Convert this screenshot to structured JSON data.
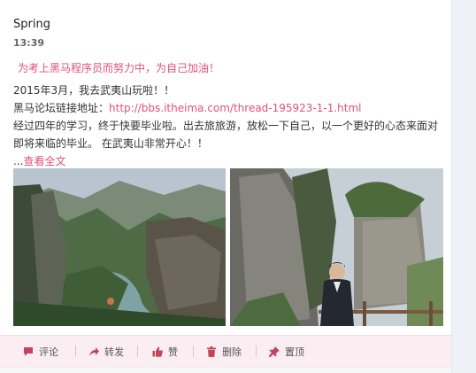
{
  "post": {
    "author": "Spring",
    "time": "13:39",
    "tagline": "为考上黑马程序员而努力中，为自己加油！",
    "line1": "2015年3月，我去武夷山玩啦！！",
    "link_prefix": "黑马论坛链接地址：",
    "link_url": "http://bbs.itheima.com/thread-195923-1-1.html",
    "body": "经过四年的学习，终于快要毕业啦。出去旅旅游，放松一下自己，以一个更好的心态来面对即将来临的毕业。 在武夷山非常开心！！",
    "more_prefix": "...",
    "more_label": "查看全文"
  },
  "photos": [
    {
      "alt": "武夷山风景"
    },
    {
      "alt": "武夷山人物照"
    }
  ],
  "actions": {
    "comment": "评论",
    "forward": "转发",
    "like": "赞",
    "delete": "删除",
    "pin": "置顶"
  },
  "colors": {
    "accent": "#e0527a",
    "action_bar": "#fbeef2"
  }
}
